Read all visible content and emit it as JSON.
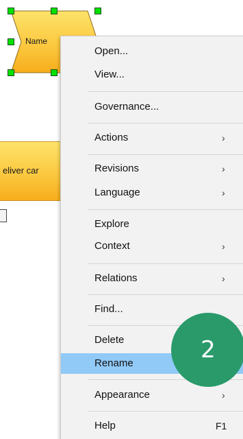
{
  "diagram": {
    "selected_shape_label": "Name",
    "second_shape_label": "eliver car",
    "shape_fill_top": "#fde36a",
    "shape_fill_bottom": "#f7ad1c",
    "selection_handle_color": "#00e000"
  },
  "context_menu": {
    "items": [
      {
        "label": "Open...",
        "has_submenu": false
      },
      {
        "label": "View...",
        "has_submenu": false
      },
      {
        "label": "Governance...",
        "has_submenu": false
      },
      {
        "label": "Actions",
        "has_submenu": true
      },
      {
        "label": "Revisions",
        "has_submenu": true
      },
      {
        "label": "Language",
        "has_submenu": true
      },
      {
        "label": "Explore",
        "has_submenu": false
      },
      {
        "label": "Context",
        "has_submenu": true
      },
      {
        "label": "Relations",
        "has_submenu": true
      },
      {
        "label": "Find...",
        "has_submenu": false
      },
      {
        "label": "Delete",
        "has_submenu": false
      },
      {
        "label": "Rename",
        "has_submenu": false,
        "highlighted": true
      },
      {
        "label": "Appearance",
        "has_submenu": true
      },
      {
        "label": "Help",
        "has_submenu": false,
        "shortcut": "F1"
      }
    ],
    "submenu_glyph": "›",
    "highlight_color": "#91c9f7"
  },
  "step_badge": {
    "number": "2",
    "color": "#2a9a6b"
  }
}
